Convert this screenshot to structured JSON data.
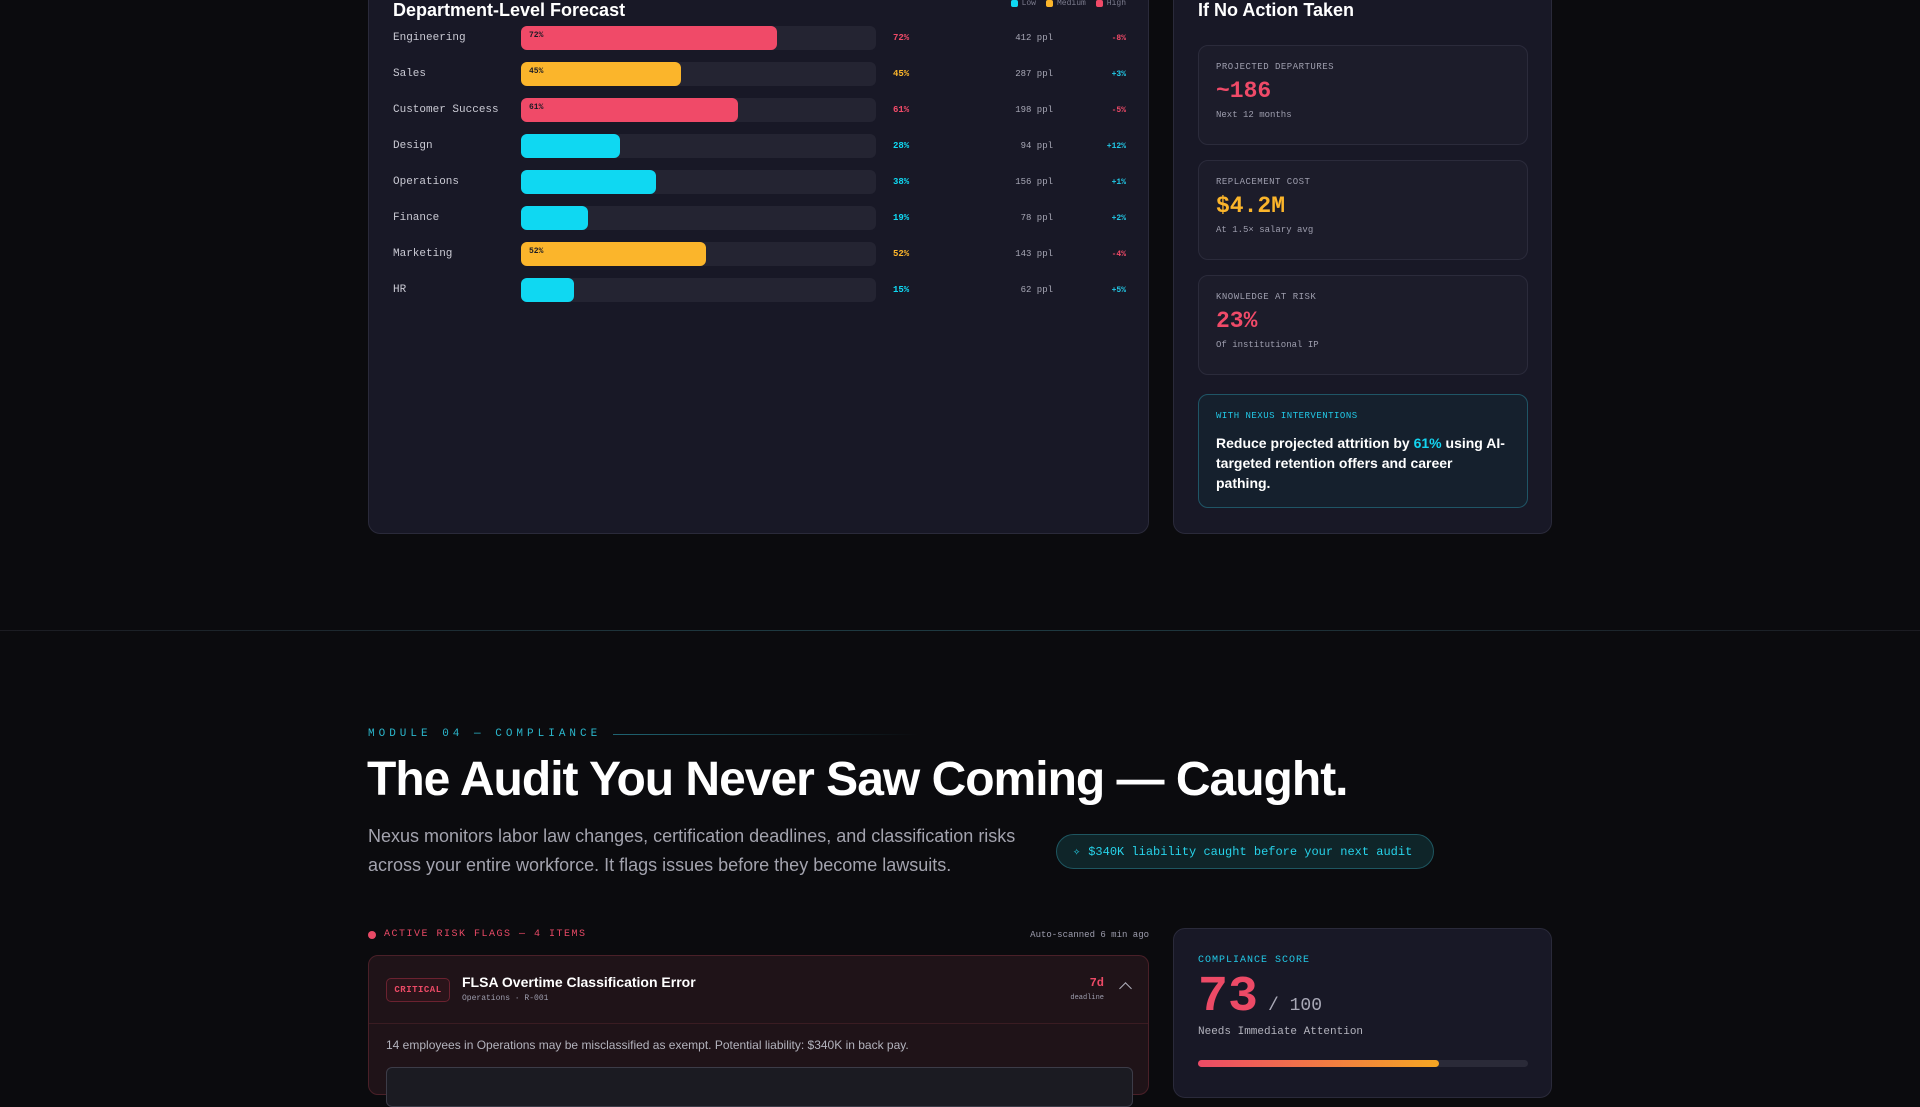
{
  "forecast": {
    "title": "Department-Level Forecast",
    "legend": [
      {
        "label": "Low",
        "color": "#0fd8f2"
      },
      {
        "label": "Medium",
        "color": "#fbb52b"
      },
      {
        "label": "High",
        "color": "#f04a68"
      }
    ],
    "rows": [
      {
        "name": "Engineering",
        "pct": 72,
        "pct_label": "72%",
        "people": "412 ppl",
        "delta": "-8%",
        "level": "high",
        "show_inner": true
      },
      {
        "name": "Sales",
        "pct": 45,
        "pct_label": "45%",
        "people": "287 ppl",
        "delta": "+3%",
        "level": "medium",
        "show_inner": true
      },
      {
        "name": "Customer Success",
        "pct": 61,
        "pct_label": "61%",
        "people": "198 ppl",
        "delta": "-5%",
        "level": "high",
        "show_inner": true
      },
      {
        "name": "Design",
        "pct": 28,
        "pct_label": "28%",
        "people": "94 ppl",
        "delta": "+12%",
        "level": "low",
        "show_inner": false
      },
      {
        "name": "Operations",
        "pct": 38,
        "pct_label": "38%",
        "people": "156 ppl",
        "delta": "+1%",
        "level": "low",
        "show_inner": false
      },
      {
        "name": "Finance",
        "pct": 19,
        "pct_label": "19%",
        "people": "78 ppl",
        "delta": "+2%",
        "level": "low",
        "show_inner": false
      },
      {
        "name": "Marketing",
        "pct": 52,
        "pct_label": "52%",
        "people": "143 ppl",
        "delta": "-4%",
        "level": "medium",
        "show_inner": true
      },
      {
        "name": "HR",
        "pct": 15,
        "pct_label": "15%",
        "people": "62 ppl",
        "delta": "+5%",
        "level": "low",
        "show_inner": false
      }
    ]
  },
  "no_action": {
    "title": "If No Action Taken",
    "cards": [
      {
        "label": "PROJECTED DEPARTURES",
        "value": "~186",
        "sub": "Next 12 months",
        "color": "#f04a68"
      },
      {
        "label": "REPLACEMENT COST",
        "value": "$4.2M",
        "sub": "At 1.5× salary avg",
        "color": "#fbb52b"
      },
      {
        "label": "KNOWLEDGE AT RISK",
        "value": "23%",
        "sub": "Of institutional IP",
        "color": "#f04a68"
      }
    ],
    "nexus": {
      "label": "WITH NEXUS INTERVENTIONS",
      "text_before": "Reduce projected attrition by ",
      "highlight": "61%",
      "text_after": " using AI-targeted retention offers and career pathing."
    }
  },
  "compliance": {
    "module_label": "MODULE 04 — COMPLIANCE",
    "headline": "The Audit You Never Saw Coming — Caught.",
    "subtext": "Nexus monitors labor law changes, certification deadlines, and classification risks across your entire workforce. It flags issues before they become lawsuits.",
    "liability_pill": "$340K liability caught before your next audit",
    "flags_title": "ACTIVE RISK FLAGS — 4 ITEMS",
    "autoscan": "Auto-scanned 6 min ago",
    "flag": {
      "badge": "CRITICAL",
      "title": "FLSA Overtime Classification Error",
      "meta": "Operations · R-001",
      "deadline_value": "7d",
      "deadline_label": "deadline",
      "description": "14 employees in Operations may be misclassified as exempt. Potential liability: $340K in back pay."
    },
    "score": {
      "label": "COMPLIANCE SCORE",
      "value": "73",
      "max": "/ 100",
      "sub": "Needs Immediate Attention",
      "progress": 0.73
    }
  }
}
